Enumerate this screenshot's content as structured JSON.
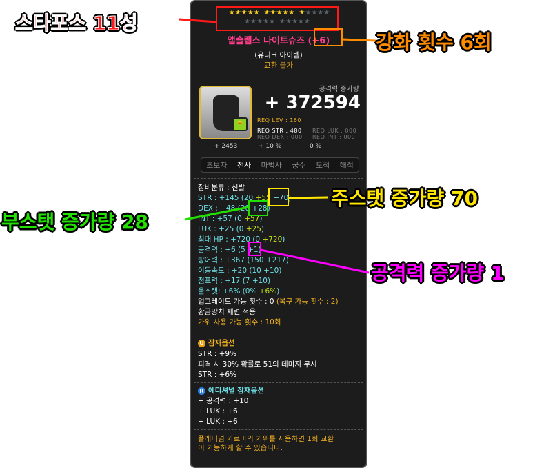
{
  "starforce": {
    "filled": 11,
    "total": 25
  },
  "item": {
    "name": "앱솔랩스 나이트슈즈",
    "enhance": "(+6)",
    "grade": "(유니크 아이템)",
    "trade": "교환 불가"
  },
  "attack_increase": {
    "label": "공격력 증가량",
    "value": "+ 372594"
  },
  "req": {
    "lev": "REQ LEV : 160",
    "str": "REQ STR : 480",
    "dex": "REQ DEX : 000",
    "luk": "REQ LUK : 000",
    "int": "REQ INT : 000"
  },
  "bottom_bar": {
    "value1": "+ 2453",
    "value2": "+ 10 %",
    "value3": "0 %"
  },
  "jobs": [
    "초보자",
    "전사",
    "마법사",
    "궁수",
    "도적",
    "해적"
  ],
  "stats": {
    "category": "장비분류 : 신발",
    "str": {
      "label": "STR : +145 (20",
      "a": "+55",
      "b": "+70",
      ")": ")"
    },
    "dex": {
      "label": "DEX : +48 (20",
      "b": "+28"
    },
    "int": {
      "label": "INT : +57 (0",
      "a": "+57"
    },
    "luk": {
      "label": "LUK : +25 (0",
      "a": "+25"
    },
    "hp": {
      "label": "최대 HP : +720 (0",
      "a": "+720"
    },
    "atk": {
      "label": "공격력 : +6 (5",
      "b": "+1"
    },
    "def": {
      "label": "방어력 : +367 (150",
      "b": "+217"
    },
    "speed": {
      "label": "이동속도 : +20 (10",
      "b": "+10"
    },
    "jump": {
      "label": "점프력 : +17 (7",
      "b": "+10"
    },
    "allstat": {
      "label": "올스탯: +6% (0%",
      "a": "+6%"
    },
    "upgrade": {
      "label": "업그레이드 가능 횟수 : 0",
      "restore": "(복구 가능 횟수 : 2)"
    },
    "hammer": "황금망치 제련 적용",
    "scissors": "가위 사용 가능 횟수 : 10회"
  },
  "potential": {
    "title": "잠재옵션",
    "badge": "U",
    "lines": [
      "STR : +9%",
      "피격 시 30% 확률로 51의 데미지 무시",
      "STR : +6%"
    ]
  },
  "additional": {
    "title": "에디셔널 잠재옵션",
    "badge": "R",
    "lines": [
      "+ 공격력 : +10",
      "+ LUK : +6",
      "+ LUK : +6"
    ]
  },
  "notice": [
    "플래티넘 카르마의 가위를 사용하면 1회 교환",
    "이 가능하게 할 수 있습니다."
  ],
  "annotations": {
    "starforce": "스타포스 11성",
    "enhance": "강화 횟수 6회",
    "main_stat": "주스탯 증가량 70",
    "sub_stat": "부스탯 증가량 28",
    "attack": "공격력 증가량 1"
  },
  "colors": {
    "red": "#ff1a1a",
    "orange": "#ff8c00",
    "yellow": "#ffe600",
    "green": "#22e000",
    "magenta": "#ff00ff"
  }
}
